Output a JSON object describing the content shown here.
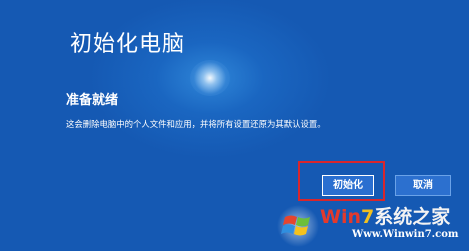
{
  "dialog": {
    "title": "初始化电脑",
    "subtitle": "准备就绪",
    "description": "这会删除电脑中的个人文件和应用，并将所有设置还原为其默认设置。"
  },
  "buttons": {
    "initialize_label": "初始化",
    "cancel_label": "取消"
  },
  "watermark": {
    "brand_part1": "Win",
    "brand_part2": "7",
    "brand_part3": "系统之家",
    "url": "Www.Winwin7.com"
  },
  "colors": {
    "background": "#1658b3",
    "highlight_border": "#d8262c",
    "text": "#ffffff"
  },
  "icons": {
    "watermark_logo": "windows-7-logo-icon"
  }
}
